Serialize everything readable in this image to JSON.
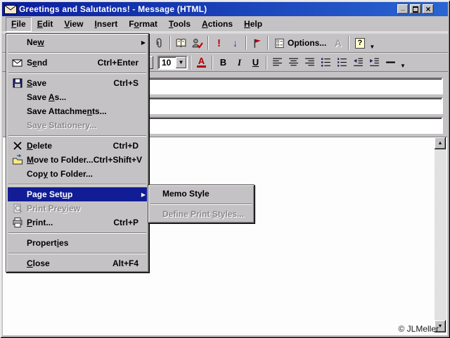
{
  "window": {
    "title": "Greetings and Salutations! - Message (HTML)",
    "credit": "© JLMeller"
  },
  "colors": {
    "titlebar_left": "#0a1d9e",
    "titlebar_right": "#2a65d2",
    "menu_highlight": "#111c95",
    "face_gray": "#c5c2c5",
    "importance_high_red": "#c00000",
    "importance_low_blue": "#2233bb",
    "font_color_red": "#b00000",
    "help_yellow": "#ffffce"
  },
  "glyphs": {
    "minimize": "_",
    "close": "×",
    "submenu_arrow": "▶",
    "combo_arrow": "▼",
    "more_arrow": "▼",
    "scroll_up": "▲",
    "scroll_down": "▼",
    "importance_high": "!",
    "importance_low": "↓",
    "help": "?"
  },
  "menubar": {
    "items": [
      {
        "pre": "",
        "key": "F",
        "post": "ile"
      },
      {
        "pre": "",
        "key": "E",
        "post": "dit"
      },
      {
        "pre": "",
        "key": "V",
        "post": "iew"
      },
      {
        "pre": "",
        "key": "I",
        "post": "nsert"
      },
      {
        "pre": "F",
        "key": "o",
        "post": "rmat"
      },
      {
        "pre": "",
        "key": "T",
        "post": "ools"
      },
      {
        "pre": "",
        "key": "A",
        "post": "ctions"
      },
      {
        "pre": "",
        "key": "H",
        "post": "elp"
      }
    ]
  },
  "toolbar_standard": {
    "options_label": "Options...",
    "letter_a_label": "A"
  },
  "toolbar_formatting": {
    "font_size_value": "10",
    "font_color_label": "A",
    "bold_label": "B",
    "italic_label": "I",
    "underline_label": "U"
  },
  "fields": {
    "to": "",
    "cc": "",
    "subject": ""
  },
  "file_menu": {
    "items": [
      {
        "pre": "Ne",
        "key": "w",
        "post": "",
        "accel": ""
      },
      {
        "pre": "S",
        "key": "e",
        "post": "nd",
        "accel": "Ctrl+Enter"
      },
      {
        "pre": "",
        "key": "S",
        "post": "ave",
        "accel": "Ctrl+S"
      },
      {
        "pre": "Save ",
        "key": "A",
        "post": "s...",
        "accel": ""
      },
      {
        "pre": "Save Attachme",
        "key": "n",
        "post": "ts...",
        "accel": ""
      },
      {
        "pre": "Sa",
        "key": "v",
        "post": "e Stationery...",
        "accel": ""
      },
      {
        "pre": "",
        "key": "D",
        "post": "elete",
        "accel": "Ctrl+D"
      },
      {
        "pre": "",
        "key": "M",
        "post": "ove to Folder...",
        "accel": "Ctrl+Shift+V"
      },
      {
        "pre": "Cop",
        "key": "y",
        "post": " to Folder...",
        "accel": ""
      },
      {
        "pre": "Page Set",
        "key": "u",
        "post": "p",
        "accel": ""
      },
      {
        "pre": "Print Pre",
        "key": "v",
        "post": "iew",
        "accel": ""
      },
      {
        "pre": "",
        "key": "P",
        "post": "rint...",
        "accel": "Ctrl+P"
      },
      {
        "pre": "Propert",
        "key": "i",
        "post": "es",
        "accel": ""
      },
      {
        "pre": "",
        "key": "C",
        "post": "lose",
        "accel": "Alt+F4"
      }
    ]
  },
  "page_setup_submenu": {
    "items": [
      {
        "pre": "Memo Style",
        "key": "",
        "post": ""
      },
      {
        "pre": "Define Print ",
        "key": "S",
        "post": "tyles..."
      }
    ]
  }
}
